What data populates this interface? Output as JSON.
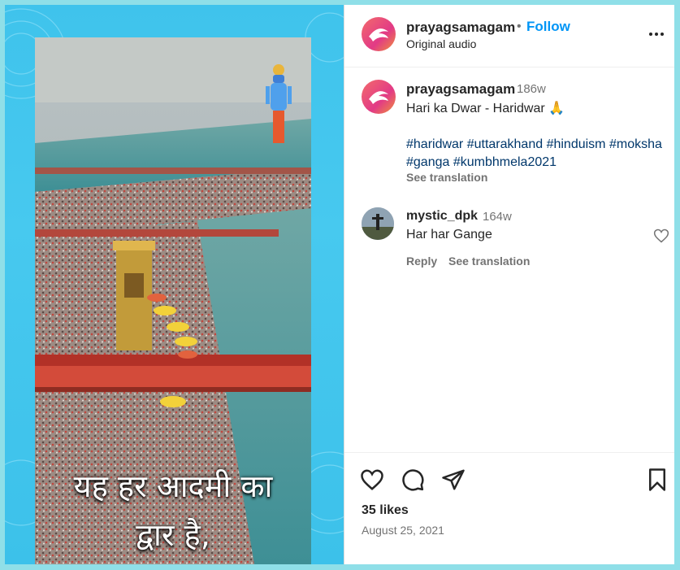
{
  "post": {
    "author": "prayagsamagam",
    "separator": "•",
    "follow_label": "Follow",
    "audio": "Original audio",
    "video_overlay_lines": [
      "यह हर आदमी का",
      "द्वार है,"
    ]
  },
  "caption": {
    "author": "prayagsamagam",
    "age": "186w",
    "text": "Hari ka Dwar - Haridwar 🙏",
    "hashtags": [
      "#haridwar",
      "#uttarakhand",
      "#hinduism",
      "#moksha",
      "#ganga",
      "#kumbhmela2021"
    ],
    "see_translation": "See translation"
  },
  "comments": [
    {
      "author": "mystic_dpk",
      "age": "164w",
      "text": "Har har Gange",
      "reply_label": "Reply",
      "see_translation": "See translation"
    }
  ],
  "footer": {
    "likes": "35 likes",
    "date": "August 25, 2021"
  },
  "icons": {
    "more": "more-options-icon",
    "like": "heart-icon",
    "comment": "comment-icon",
    "share": "share-icon",
    "save": "bookmark-icon"
  },
  "colors": {
    "follow": "#0095f6",
    "hashtag": "#00376b",
    "muted": "#737373",
    "media_background": "#47c9ef"
  }
}
